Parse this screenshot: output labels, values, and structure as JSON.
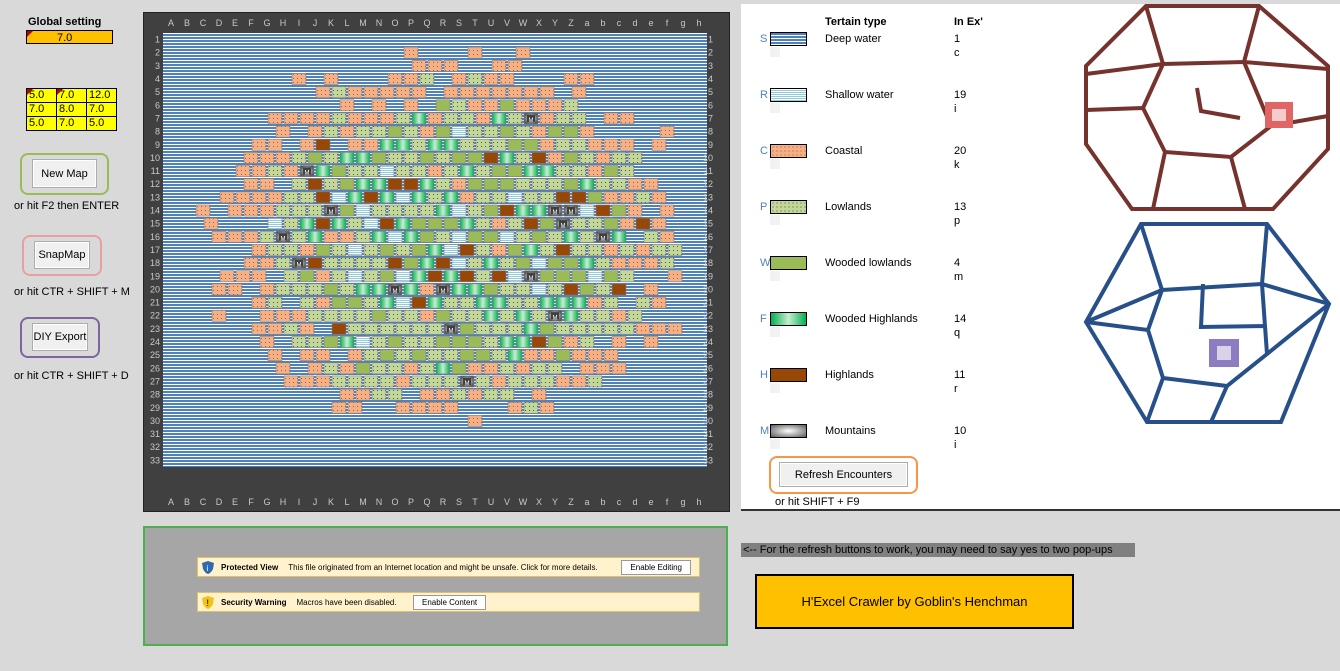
{
  "global_setting": {
    "title": "Global setting",
    "value": "7.0"
  },
  "weights": [
    [
      "5.0",
      "7.0",
      "12.0"
    ],
    [
      "7.0",
      "8.0",
      "7.0"
    ],
    [
      "5.0",
      "7.0",
      "5.0"
    ]
  ],
  "buttons": {
    "new_map": {
      "label": "New Map",
      "hint": "or hit F2 then ENTER",
      "color": "#9bbb59"
    },
    "snap_map": {
      "label": "SnapMap",
      "hint": "or hit CTR + SHIFT + M",
      "color": "#e6a0a0"
    },
    "diy_export": {
      "label": "DIY Export",
      "hint": "or hit CTR + SHIFT + D",
      "color": "#8064a2"
    },
    "refresh": {
      "label": "Refresh Encounters",
      "hint": "or hit SHIFT + F9",
      "color": "#f79646"
    }
  },
  "map": {
    "columns": [
      "A",
      "B",
      "C",
      "D",
      "E",
      "F",
      "G",
      "H",
      "I",
      "J",
      "K",
      "L",
      "M",
      "N",
      "O",
      "P",
      "Q",
      "R",
      "S",
      "T",
      "U",
      "V",
      "W",
      "X",
      "Y",
      "Z",
      "a",
      "b",
      "c",
      "d",
      "e",
      "f",
      "g",
      "h"
    ],
    "rows": [
      "1",
      "2",
      "3",
      "4",
      "5",
      "6",
      "7",
      "8",
      "9",
      "10",
      "11",
      "12",
      "13",
      "14",
      "15",
      "16",
      "17",
      "18",
      "19",
      "20",
      "21",
      "22",
      "23",
      "24",
      "25",
      "26",
      "27",
      "28",
      "29",
      "30",
      "31",
      "32",
      "33"
    ],
    "mountain_glyph": "M"
  },
  "legend": {
    "header_type": "Tertain type",
    "header_ex": "In Ex'",
    "items": [
      {
        "letter": "S",
        "name": "Deep water",
        "count": "1",
        "code": "c",
        "swatch": "deep"
      },
      {
        "letter": "R",
        "name": "Shallow water",
        "count": "19",
        "code": "i",
        "swatch": "shallow"
      },
      {
        "letter": "C",
        "name": "Coastal",
        "count": "20",
        "code": "k",
        "swatch": "coastal"
      },
      {
        "letter": "P",
        "name": "Lowlands",
        "count": "13",
        "code": "p",
        "swatch": "lowlands"
      },
      {
        "letter": "W",
        "name": "Wooded lowlands",
        "count": "4",
        "code": "m",
        "swatch": "wooded"
      },
      {
        "letter": "F",
        "name": "Wooded Highlands",
        "count": "14",
        "code": "q",
        "swatch": "woodhigh"
      },
      {
        "letter": "H",
        "name": "Highlands",
        "count": "11",
        "code": "r",
        "swatch": "highlands"
      },
      {
        "letter": "M",
        "name": "Mountains",
        "count": "10",
        "code": "i",
        "swatch": "mountains"
      }
    ]
  },
  "colors": {
    "deep": "#4f81bd",
    "shallow": "#93cddd",
    "coastal": "#f4b183",
    "lowlands": "#c4d79b",
    "wooded": "#9bbb59",
    "woodhigh": "#21b24b",
    "highlands": "#974706",
    "mountains": "#595959",
    "hex_red": "#76322d",
    "hex_blue": "#27508a"
  },
  "protected_view": {
    "title": "Protected View",
    "message": "This file originated from an Internet location and might be unsafe. Click for more details.",
    "button": "Enable Editing"
  },
  "security_warning": {
    "title": "Security Warning",
    "message": "Macros have been disabled.",
    "button": "Enable Content"
  },
  "note": "<-- For the refresh buttons to work, you may need to say yes to two pop-ups",
  "credit": "H'Excel Crawler by Goblin's Henchman"
}
